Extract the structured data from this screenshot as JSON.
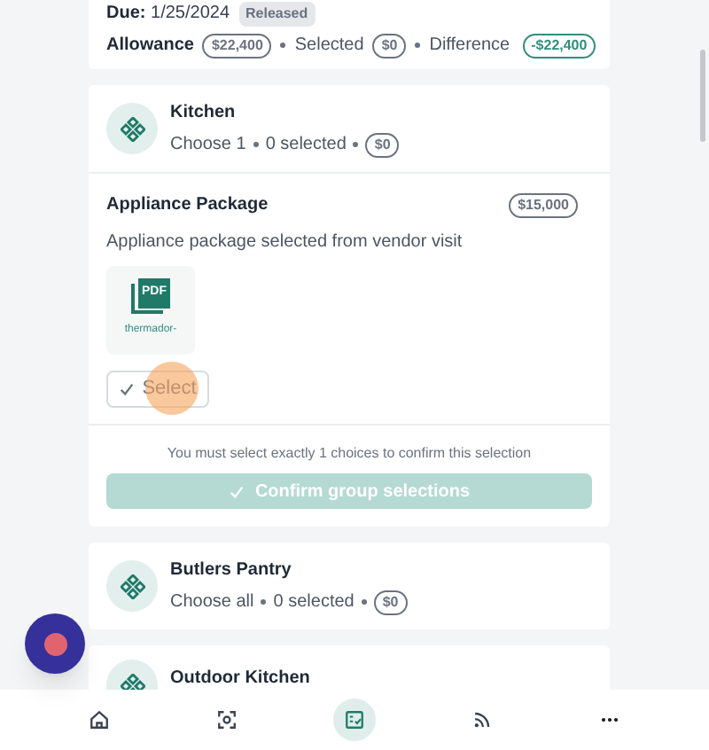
{
  "header": {
    "due_label": "Due:",
    "due_date": "1/25/2024",
    "status": "Released",
    "allowance_label": "Allowance",
    "allowance": "$22,400",
    "selected_label": "Selected",
    "selected": "$0",
    "difference_label": "Difference",
    "difference": "-$22,400"
  },
  "groups": [
    {
      "name": "Kitchen",
      "rule": "Choose 1",
      "selected_count": "0 selected",
      "total": "$0",
      "items": [
        {
          "title": "Appliance Package",
          "price": "$15,000",
          "description": "Appliance package selected from vendor visit",
          "attachments": [
            {
              "type": "PDF",
              "filename": "thermador-"
            }
          ],
          "select_label": "Select",
          "selected": false
        }
      ],
      "helper": "You must select exactly 1 choices to confirm this selection",
      "confirm_label": "Confirm group selections",
      "confirm_disabled": true
    },
    {
      "name": "Butlers Pantry",
      "rule": "Choose all",
      "selected_count": "0 selected",
      "total": "$0"
    },
    {
      "name": "Outdoor Kitchen"
    }
  ],
  "nav": [
    {
      "selected": false
    },
    {
      "selected": false
    },
    {
      "selected": true
    },
    {
      "selected": false
    },
    {
      "selected": false
    }
  ]
}
